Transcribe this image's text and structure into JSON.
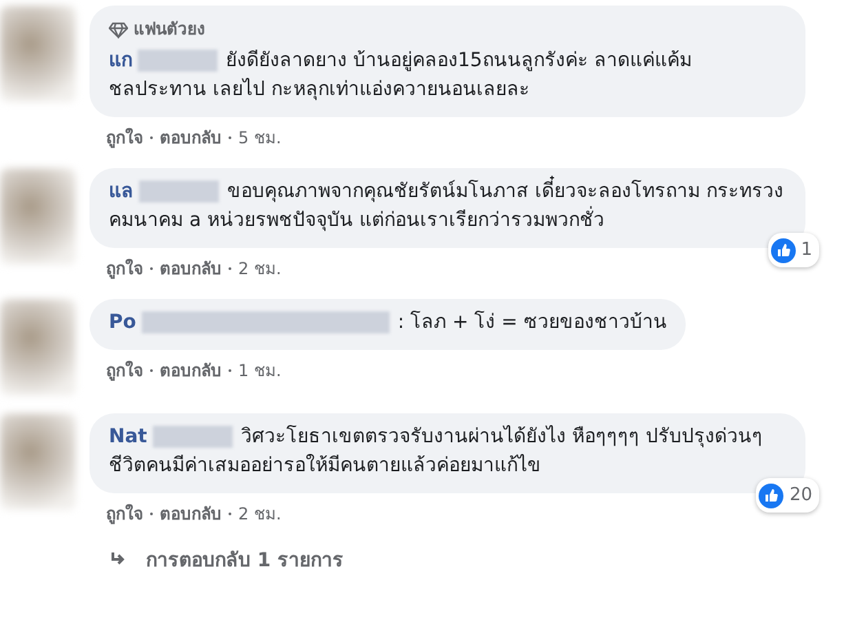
{
  "comments": [
    {
      "badge": "แฟนตัวยง",
      "author": "แก",
      "text": "ยังดียังลาดยาง บ้านอยู่คลอง15ถนนลูกรังค่ะ ลาดแค่แค้มชลประทาน เลยไป กะหลุกเท่าแอ่งควายนอนเลยละ",
      "actions": [
        "ถูกใจ",
        "ตอบกลับ",
        "5 ชม."
      ]
    },
    {
      "author": "แล",
      "text": "ขอบคุณภาพจากคุณชัยรัตน์มโนภาส เดี๋ยวจะลองโทรถาม กระทรวงคมนาคม a หน่วยรพชปัจจุบัน แต่ก่อนเราเรียกว่ารวมพวกชั่ว",
      "reactions": "1",
      "actions": [
        "ถูกใจ",
        "ตอบกลับ",
        "2 ชม."
      ]
    },
    {
      "author": "Po",
      "text": ": โลภ + โง่ = ซวยของชาวบ้าน",
      "actions": [
        "ถูกใจ",
        "ตอบกลับ",
        "1 ชม."
      ]
    },
    {
      "author": "Nat",
      "text": "วิศวะโยธาเขตตรวจรับงานผ่านได้ยังไง หือๆๆๆๆ ปรับปรุงด่วนๆชีวิตคนมีค่าเสมออย่ารอให้มีคนตายแล้วค่อยมาแก้ไข",
      "reactions": "20",
      "actions": [
        "ถูกใจ",
        "ตอบกลับ",
        "2 ชม."
      ]
    }
  ],
  "replies_link": "การตอบกลับ 1 รายการ"
}
